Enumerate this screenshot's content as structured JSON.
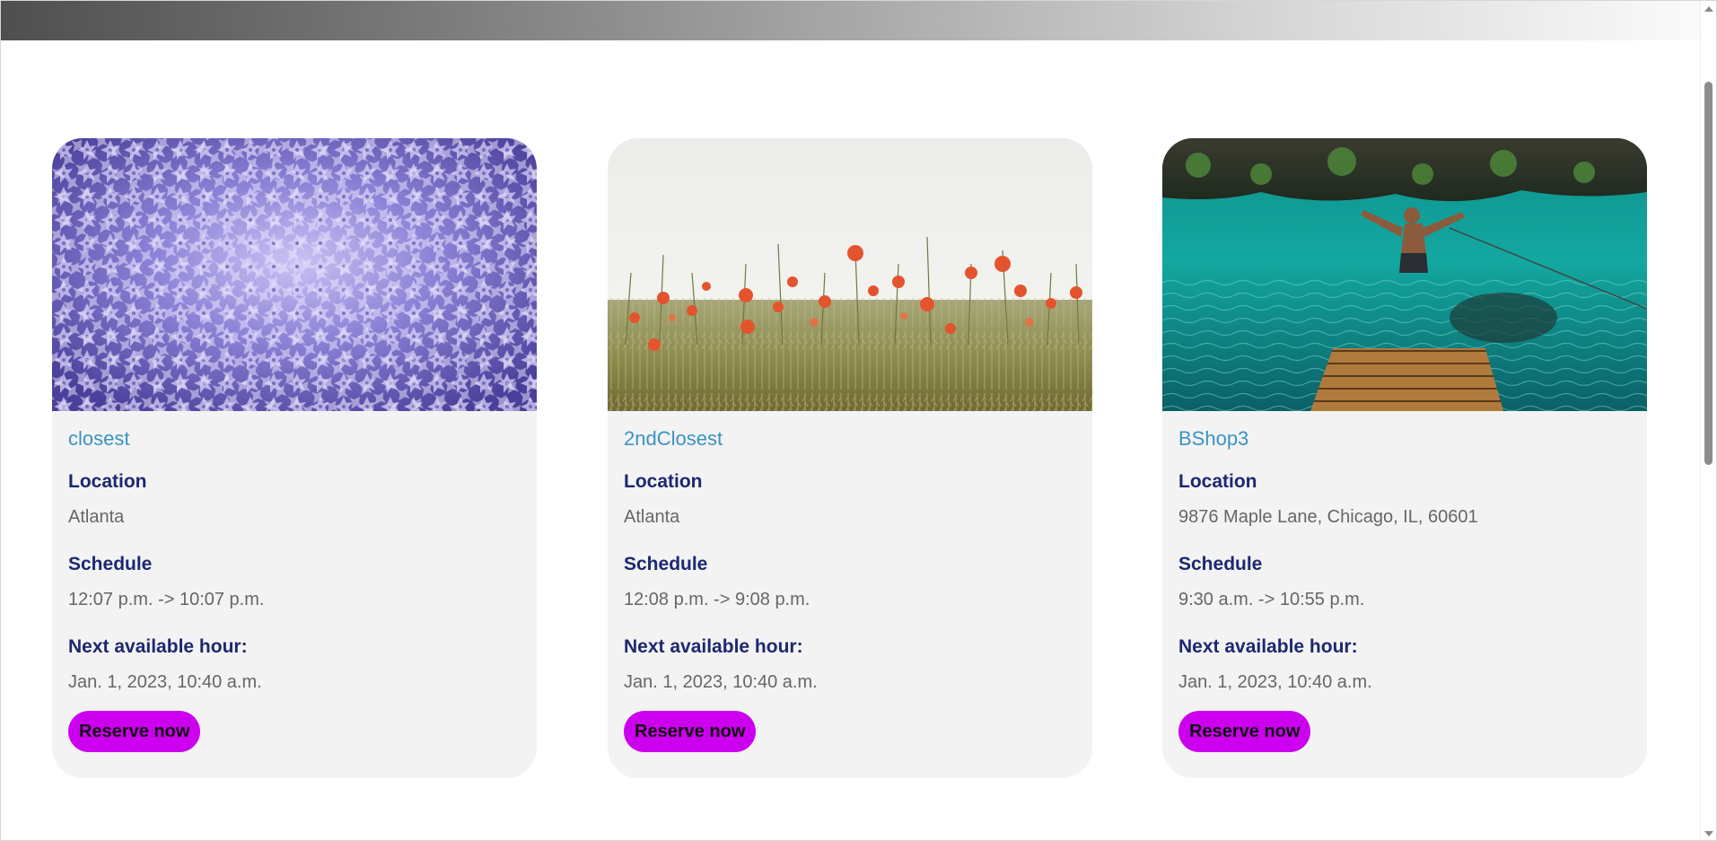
{
  "cards": [
    {
      "title": "closest",
      "image": "frosted-pine-forest-aerial",
      "location_label": "Location",
      "location": "Atlanta",
      "schedule_label": "Schedule",
      "schedule": "12:07 p.m. -> 10:07 p.m.",
      "next_label": "Next available hour:",
      "next": "Jan. 1, 2023, 10:40 a.m.",
      "button_label": "Reserve now"
    },
    {
      "title": "2ndClosest",
      "image": "poppy-wheat-field",
      "location_label": "Location",
      "location": "Atlanta",
      "schedule_label": "Schedule",
      "schedule": "12:08 p.m. -> 9:08 p.m.",
      "next_label": "Next available hour:",
      "next": "Jan. 1, 2023, 10:40 a.m.",
      "button_label": "Reserve now"
    },
    {
      "title": "BShop3",
      "image": "lagoon-jump-dock",
      "location_label": "Location",
      "location": "9876 Maple Lane, Chicago, IL, 60601",
      "schedule_label": "Schedule",
      "schedule": "9:30 a.m. -> 10:55 p.m.",
      "next_label": "Next available hour:",
      "next": "Jan. 1, 2023, 10:40 a.m.",
      "button_label": "Reserve now"
    }
  ],
  "colors": {
    "title": "#3a93c4",
    "label": "#1c2870",
    "value": "#666666",
    "button": "#cc00ee",
    "card_background": "#f3f3f3"
  }
}
